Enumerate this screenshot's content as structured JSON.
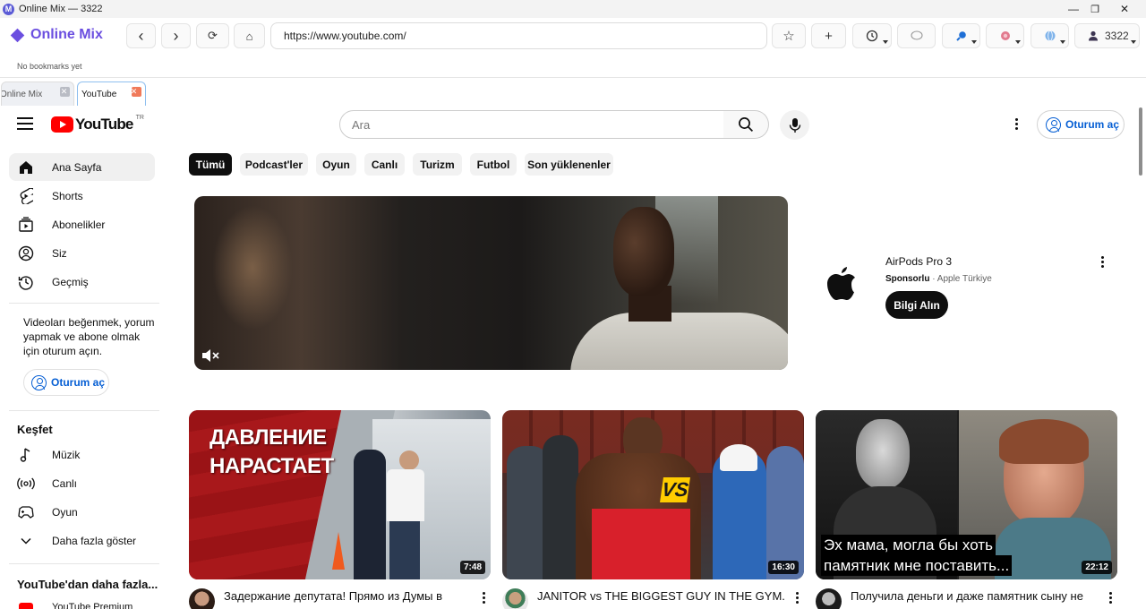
{
  "window": {
    "title": "Online Mix — 3322",
    "minimize_glyph": "—",
    "maximize_glyph": "❐",
    "close_glyph": "✕"
  },
  "browser": {
    "brand": "Online Mix",
    "url": "https://www.youtube.com/",
    "profile_label": "3322",
    "bookmarks_text": "No bookmarks yet",
    "nav": {
      "back": "‹",
      "forward": "›",
      "reload": "⟳",
      "home": "⌂",
      "bookmark": "☆",
      "new_tab": "+"
    },
    "tabs": [
      {
        "label": "Online Mix",
        "active": false
      },
      {
        "label": "YouTube",
        "active": true
      }
    ],
    "accent_color": "#6b4fe0"
  },
  "youtube": {
    "logo_text": "YouTube",
    "country_code": "TR",
    "search_placeholder": "Ara",
    "signin_label": "Oturum aç",
    "sidebar": {
      "primary": [
        {
          "label": "Ana Sayfa",
          "icon": "home-icon",
          "active": true
        },
        {
          "label": "Shorts",
          "icon": "shorts-icon",
          "active": false
        },
        {
          "label": "Abonelikler",
          "icon": "subscriptions-icon",
          "active": false
        },
        {
          "label": "Siz",
          "icon": "you-icon",
          "active": false
        },
        {
          "label": "Geçmiş",
          "icon": "history-icon",
          "active": false
        }
      ],
      "signin_note": "Videoları beğenmek, yorum yapmak ve abone olmak için oturum açın.",
      "explore_heading": "Keşfet",
      "explore": [
        {
          "label": "Müzik",
          "icon": "music-icon"
        },
        {
          "label": "Canlı",
          "icon": "live-icon"
        },
        {
          "label": "Oyun",
          "icon": "gaming-icon"
        },
        {
          "label": "Daha fazla göster",
          "icon": "chevron-down-icon"
        }
      ],
      "more_heading": "YouTube'dan daha fazla...",
      "more_item": "YouTube Premium"
    },
    "chips": [
      "Tümü",
      "Podcast'ler",
      "Oyun",
      "Canlı",
      "Turizm",
      "Futbol",
      "Son yüklenenler"
    ],
    "ad": {
      "title": "AirPods Pro 3",
      "sponsored": "Sponsorlu",
      "advertiser": "Apple Türkiye",
      "cta": "Bilgi Alın"
    },
    "videos": [
      {
        "title": "Задержание депутата! Прямо из Думы в",
        "duration": "7:48",
        "thumb_text": [
          "ДАВЛЕНИЕ",
          "НАРАСТАЕТ"
        ]
      },
      {
        "title": "JANITOR vs THE BIGGEST GUY IN THE GYM. HE",
        "duration": "16:30",
        "thumb_text": [
          "VS"
        ]
      },
      {
        "title": "Получила деньги и даже памятник сыну не",
        "duration": "22:12",
        "thumb_text": [
          "Эх мама, могла бы хоть",
          "памятник мне поставить..."
        ]
      }
    ]
  }
}
